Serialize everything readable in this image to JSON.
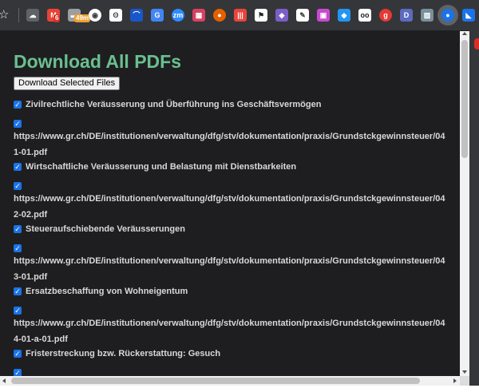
{
  "browser": {
    "extensions": [
      {
        "name": "cloud-icon",
        "glyph": "☁",
        "color": "#5f6368",
        "badge": "",
        "badge_color": ""
      },
      {
        "name": "gmail-icon",
        "glyph": "M",
        "color": "#ea4335",
        "badge": "6",
        "badge_color": "#d93025"
      },
      {
        "name": "calendar-icon",
        "glyph": "▬",
        "color": "#9e9e9e",
        "badge": "49m",
        "badge_color": "#f0a030"
      },
      {
        "name": "circle-target-icon",
        "glyph": "◉",
        "color": "#3c4043",
        "badge": "",
        "badge_color": ""
      },
      {
        "name": "owl-icon",
        "glyph": "ʘ",
        "color": "#3c4043",
        "badge": "",
        "badge_color": ""
      },
      {
        "name": "arc-icon",
        "glyph": "⌒",
        "color": "#1a56c9",
        "badge": "",
        "badge_color": ""
      },
      {
        "name": "translate-icon",
        "glyph": "G",
        "color": "#4285f4",
        "badge": "",
        "badge_color": ""
      },
      {
        "name": "zoom-icon",
        "glyph": "zm",
        "color": "#2d8cff",
        "badge": "",
        "badge_color": ""
      },
      {
        "name": "creeper-icon",
        "glyph": "▦",
        "color": "#d94060",
        "badge": "",
        "badge_color": ""
      },
      {
        "name": "firefox-icon",
        "glyph": "●",
        "color": "#e66000",
        "badge": "",
        "badge_color": ""
      },
      {
        "name": "audio-bars-icon",
        "glyph": "|||",
        "color": "#e8453c",
        "badge": "",
        "badge_color": ""
      },
      {
        "name": "flag-icon",
        "glyph": "⚑",
        "color": "#202124",
        "badge": "",
        "badge_color": ""
      },
      {
        "name": "tag-icon",
        "glyph": "◆",
        "color": "#7b5ec8",
        "badge": "",
        "badge_color": ""
      },
      {
        "name": "eyedropper-icon",
        "glyph": "✎",
        "color": "#3c4043",
        "badge": "",
        "badge_color": ""
      },
      {
        "name": "gallery-icon",
        "glyph": "▣",
        "color": "#c84ad0",
        "badge": "",
        "badge_color": ""
      },
      {
        "name": "gem-icon",
        "glyph": "◆",
        "color": "#2196f3",
        "badge": "",
        "badge_color": ""
      },
      {
        "name": "glasses-icon",
        "glyph": "oo",
        "color": "#202124",
        "badge": "",
        "badge_color": ""
      },
      {
        "name": "g-circle-icon",
        "glyph": "g",
        "color": "#e53935",
        "badge": "",
        "badge_color": ""
      },
      {
        "name": "d-square-icon",
        "glyph": "D",
        "color": "#5c6bc0",
        "badge": "",
        "badge_color": ""
      },
      {
        "name": "image-icon",
        "glyph": "▨",
        "color": "#78909c",
        "badge": "",
        "badge_color": ""
      },
      {
        "name": "puzzle-active-icon",
        "glyph": "●",
        "color": "#1a73e8",
        "badge": "",
        "badge_color": ""
      },
      {
        "name": "partial-icon",
        "glyph": "◣",
        "color": "#1a73e8",
        "badge": "",
        "badge_color": ""
      }
    ]
  },
  "page": {
    "title": "Download All PDFs",
    "download_button": "Download Selected Files",
    "checkbox_glyph": "✓",
    "items": [
      {
        "title": "Zivilrechtliche Veräusserung und Überführung ins Geschäftsvermögen",
        "url": "https://www.gr.ch/DE/institutionen/verwaltung/dfg/stv/dokumentation/praxis/Grundstckgewinnsteuer/041-01.pdf"
      },
      {
        "title": "Wirtschaftliche Veräusserung und Belastung mit Dienstbarkeiten",
        "url": "https://www.gr.ch/DE/institutionen/verwaltung/dfg/stv/dokumentation/praxis/Grundstckgewinnsteuer/042-02.pdf"
      },
      {
        "title": "Steueraufschiebende Veräusserungen",
        "url": "https://www.gr.ch/DE/institutionen/verwaltung/dfg/stv/dokumentation/praxis/Grundstckgewinnsteuer/043-01.pdf"
      },
      {
        "title": "Ersatzbeschaffung von Wohneigentum",
        "url": "https://www.gr.ch/DE/institutionen/verwaltung/dfg/stv/dokumentation/praxis/Grundstckgewinnsteuer/044-01-a-01.pdf"
      },
      {
        "title": "Fristerstreckung bzw. Rückerstattung: Gesuch",
        "url": ""
      }
    ]
  }
}
